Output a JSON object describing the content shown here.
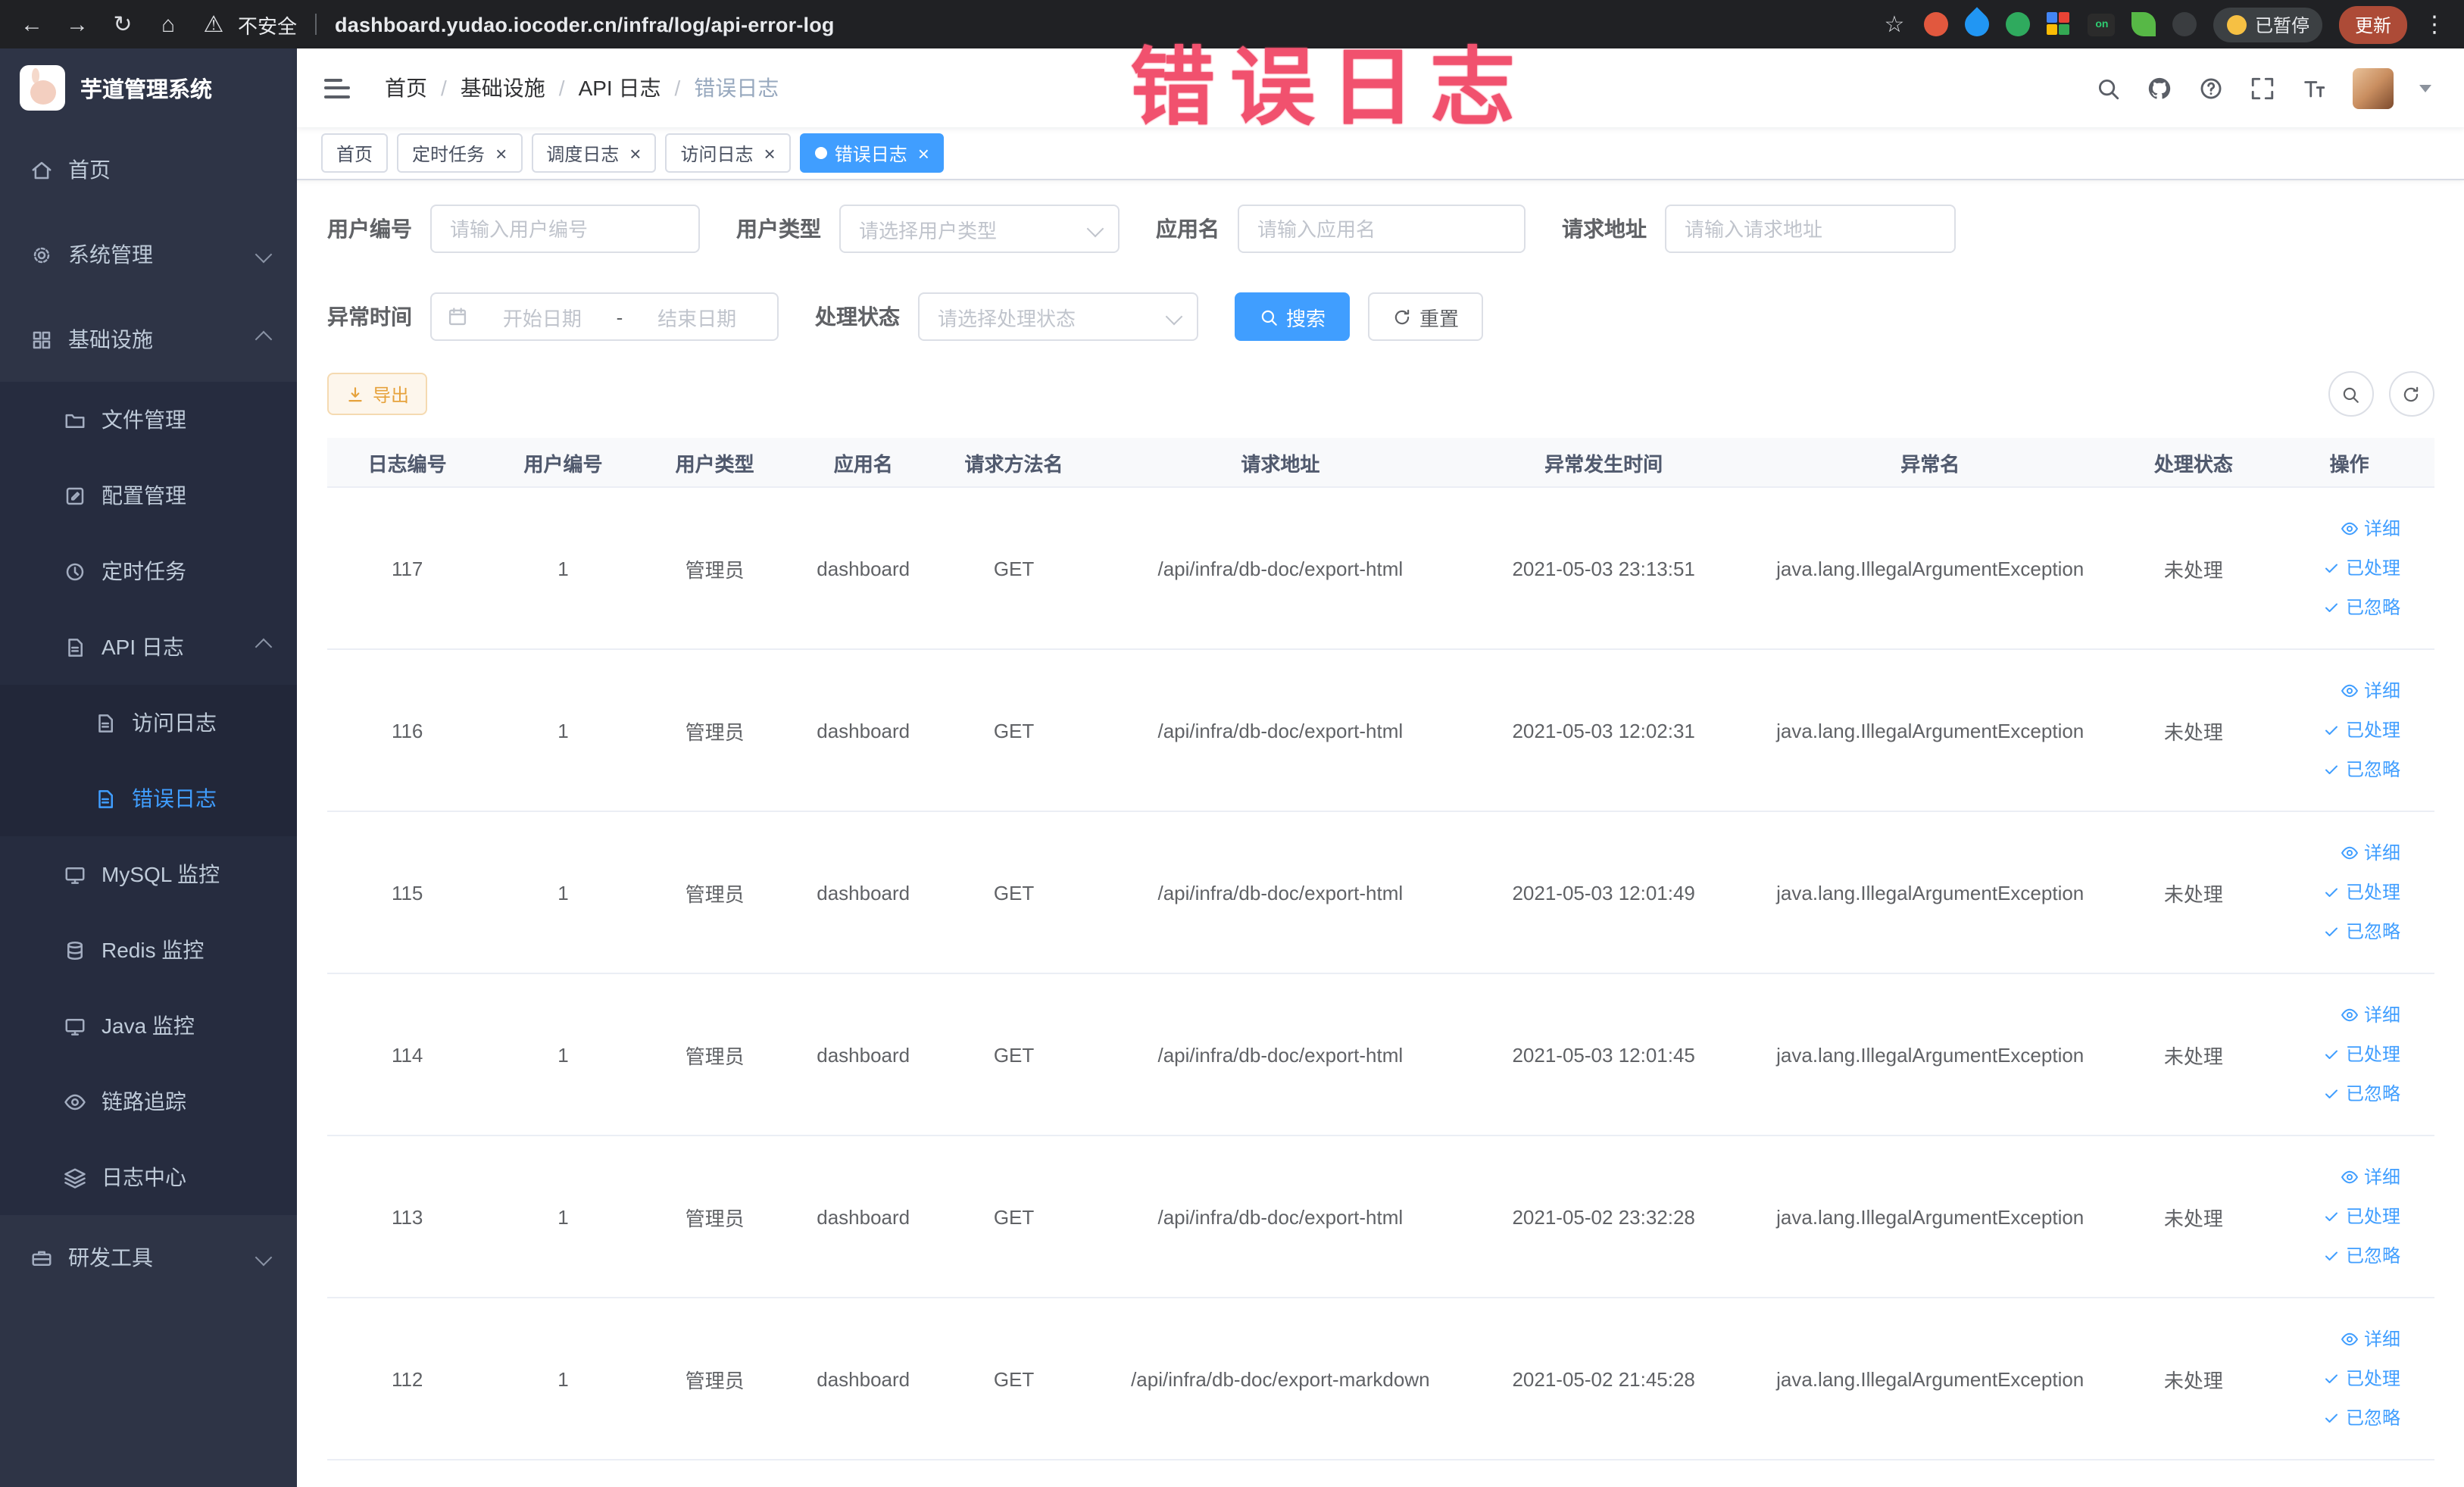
{
  "theme": {
    "accent": "#409eff",
    "sidebar_bg": "#2e3446",
    "annotation_color": "#f1516e",
    "update_button_color": "#ad4b37"
  },
  "annotation": {
    "text": "错误日志"
  },
  "browser": {
    "nav_icons": [
      "back-icon",
      "forward-icon",
      "reload-icon",
      "home-icon"
    ],
    "security_label": "不安全",
    "url": "dashboard.yudao.iocoder.cn/infra/log/api-error-log",
    "extensions": [
      {
        "name": "extension-orange-icon",
        "color": "#e1583e",
        "shape": "circle"
      },
      {
        "name": "extension-blue-drop-icon",
        "color": "#2196f3",
        "shape": "drop"
      },
      {
        "name": "extension-green-check-icon",
        "color": "#2faa5e",
        "shape": "circle"
      },
      {
        "name": "extension-color-grid-icon",
        "color": "#4285f4",
        "shape": "grid"
      },
      {
        "name": "extension-on-badge-icon",
        "color": "#2b2b2b",
        "shape": "badge",
        "label": "on",
        "label_color": "#2ecc71"
      },
      {
        "name": "extension-leaf-icon",
        "color": "#57b846",
        "shape": "leaf"
      },
      {
        "name": "extension-dark-icon",
        "color": "#3a3d40",
        "shape": "circle"
      }
    ],
    "paused_badge": "已暂停",
    "update_button": "更新"
  },
  "sidebar": {
    "logo_title": "芋道管理系统",
    "items": [
      {
        "label": "首页",
        "icon": "home-icon",
        "level": 0
      },
      {
        "label": "系统管理",
        "icon": "gear-icon",
        "level": 0,
        "chevron": "down"
      },
      {
        "label": "基础设施",
        "icon": "grid-icon",
        "level": 0,
        "chevron": "up"
      },
      {
        "label": "文件管理",
        "icon": "folder-icon",
        "level": 1
      },
      {
        "label": "配置管理",
        "icon": "edit-icon",
        "level": 1
      },
      {
        "label": "定时任务",
        "icon": "clock-icon",
        "level": 1
      },
      {
        "label": "API 日志",
        "icon": "doc-icon",
        "level": 1,
        "chevron": "up"
      },
      {
        "label": "访问日志",
        "icon": "doc-icon",
        "level": 2
      },
      {
        "label": "错误日志",
        "icon": "doc-icon",
        "level": 2,
        "active": true
      },
      {
        "label": "MySQL 监控",
        "icon": "monitor-icon",
        "level": 1
      },
      {
        "label": "Redis 监控",
        "icon": "db-icon",
        "level": 1
      },
      {
        "label": "Java 监控",
        "icon": "monitor-icon",
        "level": 1
      },
      {
        "label": "链路追踪",
        "icon": "eye-icon",
        "level": 1
      },
      {
        "label": "日志中心",
        "icon": "layers-icon",
        "level": 1
      },
      {
        "label": "研发工具",
        "icon": "tool-icon",
        "level": 0,
        "chevron": "down"
      }
    ]
  },
  "header": {
    "breadcrumb": [
      {
        "label": "首页",
        "current": false
      },
      {
        "label": "基础设施",
        "current": false
      },
      {
        "label": "API 日志",
        "current": false
      },
      {
        "label": "错误日志",
        "current": true
      }
    ],
    "icons": [
      "search-icon",
      "github-icon",
      "question-icon",
      "fullscreen-icon",
      "font-size-icon"
    ]
  },
  "tabs": [
    {
      "label": "首页",
      "closable": false,
      "active": false
    },
    {
      "label": "定时任务",
      "closable": true,
      "active": false
    },
    {
      "label": "调度日志",
      "closable": true,
      "active": false
    },
    {
      "label": "访问日志",
      "closable": true,
      "active": false
    },
    {
      "label": "错误日志",
      "closable": true,
      "active": true
    }
  ],
  "filters": {
    "user_id": {
      "label": "用户编号",
      "placeholder": "请输入用户编号"
    },
    "user_type": {
      "label": "用户类型",
      "placeholder": "请选择用户类型"
    },
    "app_name": {
      "label": "应用名",
      "placeholder": "请输入应用名"
    },
    "request_url": {
      "label": "请求地址",
      "placeholder": "请输入请求地址"
    },
    "exception_time": {
      "label": "异常时间",
      "start_placeholder": "开始日期",
      "separator": "-",
      "end_placeholder": "结束日期"
    },
    "process_status": {
      "label": "处理状态",
      "placeholder": "请选择处理状态"
    },
    "search_button": "搜索",
    "reset_button": "重置"
  },
  "toolbar": {
    "export_button": "导出"
  },
  "table": {
    "columns": [
      "日志编号",
      "用户编号",
      "用户类型",
      "应用名",
      "请求方法名",
      "请求地址",
      "异常发生时间",
      "异常名",
      "处理状态",
      "操作"
    ],
    "action_labels": {
      "detail": "详细",
      "processed": "已处理",
      "ignored": "已忽略"
    },
    "rows": [
      {
        "id": "117",
        "user_id": "1",
        "user_type": "管理员",
        "app": "dashboard",
        "method": "GET",
        "url": "/api/infra/db-doc/export-html",
        "time": "2021-05-03 23:13:51",
        "exception": "java.lang.IllegalArgumentException",
        "status": "未处理"
      },
      {
        "id": "116",
        "user_id": "1",
        "user_type": "管理员",
        "app": "dashboard",
        "method": "GET",
        "url": "/api/infra/db-doc/export-html",
        "time": "2021-05-03 12:02:31",
        "exception": "java.lang.IllegalArgumentException",
        "status": "未处理"
      },
      {
        "id": "115",
        "user_id": "1",
        "user_type": "管理员",
        "app": "dashboard",
        "method": "GET",
        "url": "/api/infra/db-doc/export-html",
        "time": "2021-05-03 12:01:49",
        "exception": "java.lang.IllegalArgumentException",
        "status": "未处理"
      },
      {
        "id": "114",
        "user_id": "1",
        "user_type": "管理员",
        "app": "dashboard",
        "method": "GET",
        "url": "/api/infra/db-doc/export-html",
        "time": "2021-05-03 12:01:45",
        "exception": "java.lang.IllegalArgumentException",
        "status": "未处理"
      },
      {
        "id": "113",
        "user_id": "1",
        "user_type": "管理员",
        "app": "dashboard",
        "method": "GET",
        "url": "/api/infra/db-doc/export-html",
        "time": "2021-05-02 23:32:28",
        "exception": "java.lang.IllegalArgumentException",
        "status": "未处理"
      },
      {
        "id": "112",
        "user_id": "1",
        "user_type": "管理员",
        "app": "dashboard",
        "method": "GET",
        "url": "/api/infra/db-doc/export-markdown",
        "time": "2021-05-02 21:45:28",
        "exception": "java.lang.IllegalArgumentException",
        "status": "未处理"
      }
    ]
  }
}
